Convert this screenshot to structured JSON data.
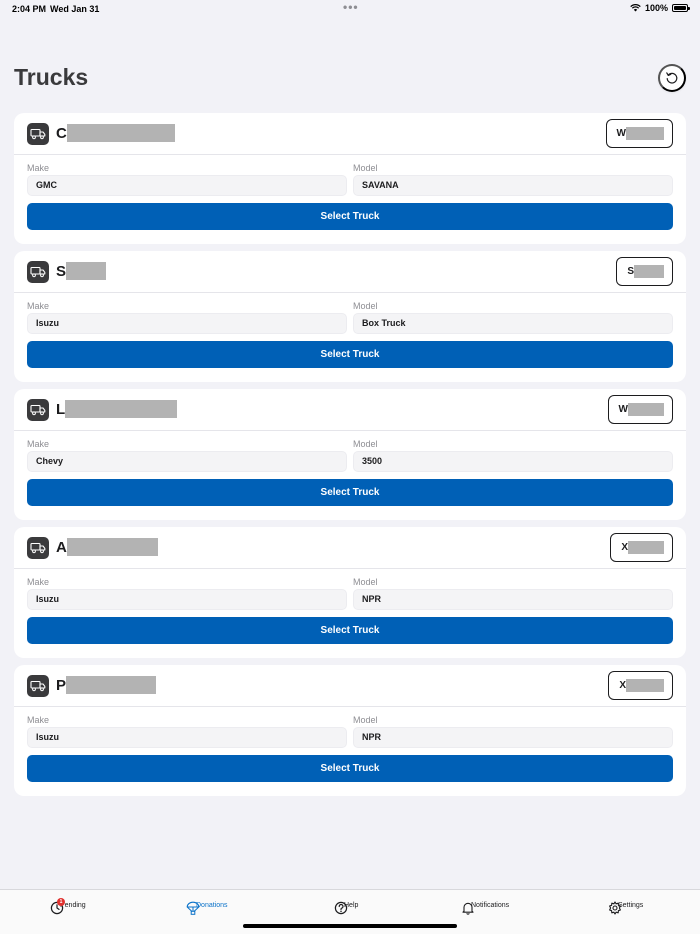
{
  "status_bar": {
    "time": "2:04 PM",
    "date": "Wed Jan 31",
    "battery": "100%"
  },
  "page": {
    "title": "Trucks",
    "refresh_icon": "refresh-icon"
  },
  "trucks": [
    {
      "name_initial": "C",
      "unit_initial": "W",
      "make_label": "Make",
      "make": "GMC",
      "model_label": "Model",
      "model": "SAVANA",
      "button_label": "Select Truck"
    },
    {
      "name_initial": "S",
      "unit_initial": "S",
      "make_label": "Make",
      "make": "Isuzu",
      "model_label": "Model",
      "model": "Box Truck",
      "button_label": "Select Truck"
    },
    {
      "name_initial": "L",
      "unit_initial": "W",
      "make_label": "Make",
      "make": "Chevy",
      "model_label": "Model",
      "model": "3500",
      "button_label": "Select Truck"
    },
    {
      "name_initial": "A",
      "unit_initial": "X",
      "make_label": "Make",
      "make": "Isuzu",
      "model_label": "Model",
      "model": "NPR",
      "button_label": "Select Truck"
    },
    {
      "name_initial": "P",
      "unit_initial": "X",
      "make_label": "Make",
      "make": "Isuzu",
      "model_label": "Model",
      "model": "NPR",
      "button_label": "Select Truck"
    }
  ],
  "tab_bar": {
    "items": [
      {
        "label": "Pending",
        "icon": "clock-icon",
        "badge": "1",
        "active": false
      },
      {
        "label": "Donations",
        "icon": "parachute-icon",
        "active": true
      },
      {
        "label": "Help",
        "icon": "help-icon",
        "active": false
      },
      {
        "label": "Notifications",
        "icon": "bell-icon",
        "active": false
      },
      {
        "label": "Settings",
        "icon": "gear-icon",
        "active": false
      }
    ]
  },
  "colors": {
    "accent": "#0060b6",
    "active_tab": "#0a72c9",
    "badge": "#e0322f",
    "background": "#f2f2f7"
  }
}
